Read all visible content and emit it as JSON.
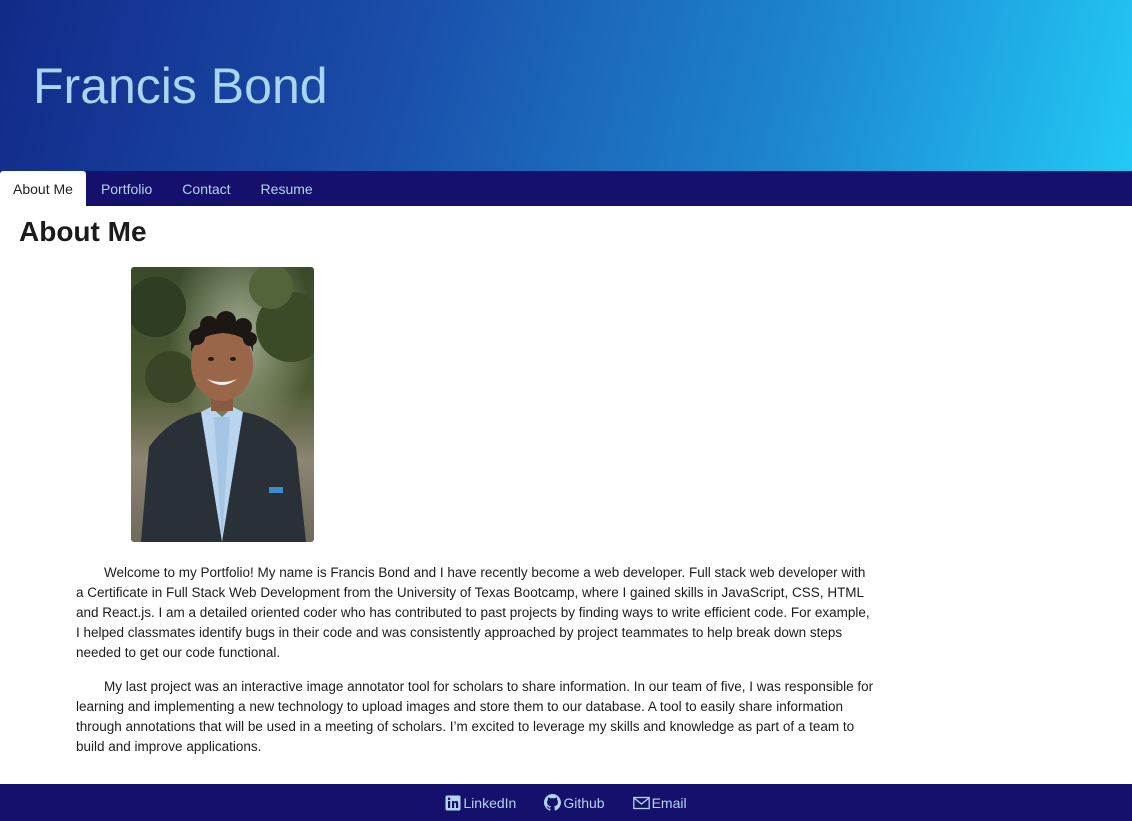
{
  "header": {
    "title": "Francis Bond"
  },
  "nav": {
    "tabs": [
      {
        "label": "About Me",
        "active": true
      },
      {
        "label": "Portfolio",
        "active": false
      },
      {
        "label": "Contact",
        "active": false
      },
      {
        "label": "Resume",
        "active": false
      }
    ]
  },
  "main": {
    "heading": "About Me",
    "paragraphs": [
      "Welcome to my Portfolio! My name is Francis Bond and I have recently become a web developer. Full stack web developer with a Certificate in Full Stack Web Development from the University of Texas Bootcamp, where I gained skills in JavaScript, CSS, HTML and React.js. I am a detailed oriented coder who has contributed to past projects by finding ways to write efficient code. For example, I helped classmates identify bugs in their code and was consistently approached by project teammates to help break down steps needed to get our code functional.",
      "My last project was an interactive image annotator tool for scholars to share information. In our team of five, I was responsible for learning and implementing a new technology to upload images and store them to our database. A tool to easily share information through annotations that will be used in a meeting of scholars. I’m excited to leverage my skills and knowledge as part of a team to build and improve applications."
    ]
  },
  "footer": {
    "links": [
      {
        "label": "LinkedIn",
        "icon": "linkedin-icon"
      },
      {
        "label": "Github",
        "icon": "github-icon"
      },
      {
        "label": "Email",
        "icon": "envelope-icon"
      }
    ]
  },
  "colors": {
    "nav_background": "#14106b",
    "nav_text": "#b4d4f2",
    "title_text": "#a9d6ee",
    "hero_gradient_start": "#122a88",
    "hero_gradient_end": "#22c9f5"
  }
}
